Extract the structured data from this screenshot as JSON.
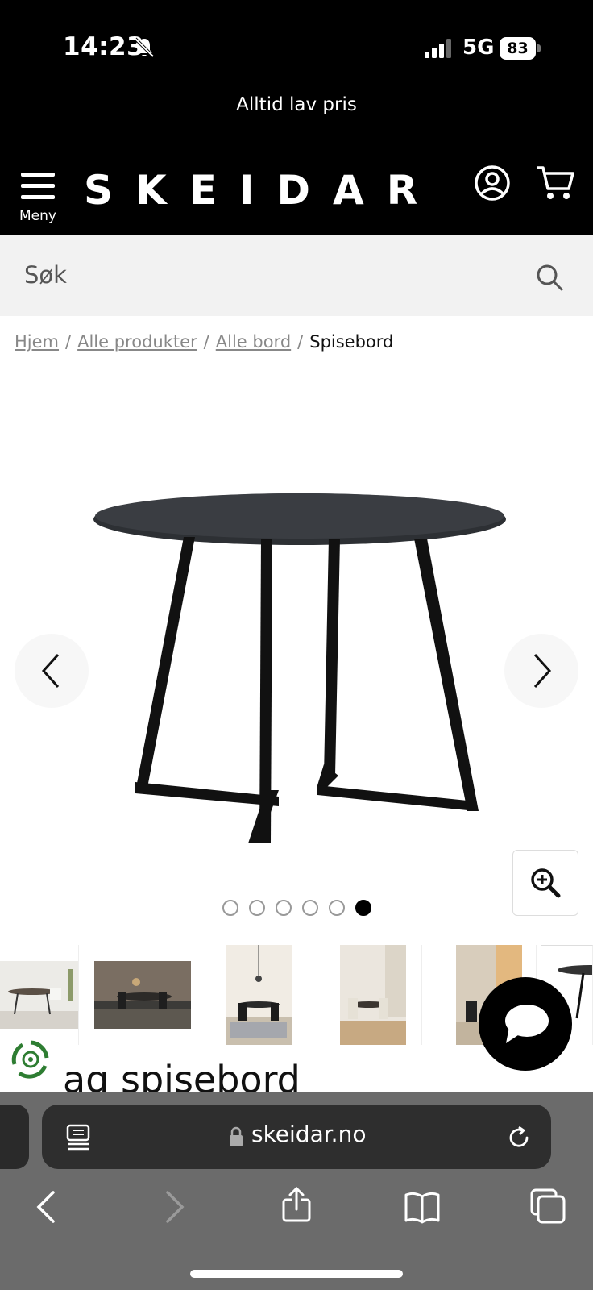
{
  "status_bar": {
    "time": "14:23",
    "network": "5G",
    "battery": "83"
  },
  "promo": {
    "text": "Alltid lav pris"
  },
  "header": {
    "menu_label": "Meny",
    "logo": "SKEIDAR"
  },
  "search": {
    "placeholder": "Søk"
  },
  "breadcrumb": {
    "items": [
      "Hjem",
      "Alle produkter",
      "Alle bord"
    ],
    "current": "Spisebord"
  },
  "carousel": {
    "total_images": 6,
    "active_index": 6
  },
  "product": {
    "title_partial": "ag spisebord"
  },
  "browser": {
    "url": "skeidar.no"
  }
}
